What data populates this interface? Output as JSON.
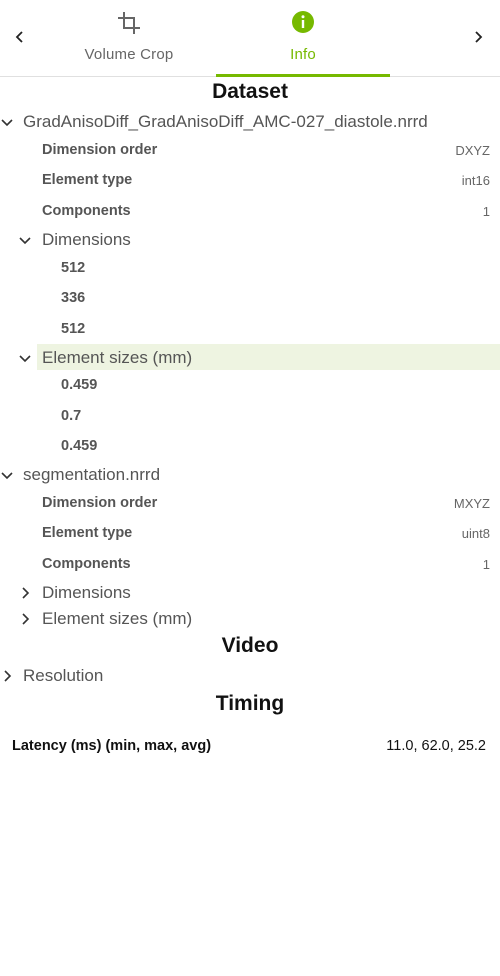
{
  "tabs": {
    "crop_label": "Volume Crop",
    "info_label": "Info"
  },
  "colors": {
    "accent": "#76b900",
    "highlight": "#eef4e1"
  },
  "dataset": {
    "title": "Dataset",
    "volumes": [
      {
        "name": "GradAnisoDiff_GradAnisoDiff_AMC-027_diastole.nrrd",
        "dimension_order_label": "Dimension order",
        "dimension_order": "DXYZ",
        "element_type_label": "Element type",
        "element_type": "int16",
        "components_label": "Components",
        "components": "1",
        "dimensions_label": "Dimensions",
        "dimensions": [
          "512",
          "336",
          "512"
        ],
        "element_sizes_label": "Element sizes (mm)",
        "element_sizes": [
          "0.459",
          "0.7",
          "0.459"
        ]
      },
      {
        "name": "segmentation.nrrd",
        "dimension_order_label": "Dimension order",
        "dimension_order": "MXYZ",
        "element_type_label": "Element type",
        "element_type": "uint8",
        "components_label": "Components",
        "components": "1",
        "dimensions_label": "Dimensions",
        "element_sizes_label": "Element sizes (mm)"
      }
    ]
  },
  "video": {
    "title": "Video",
    "resolution_label": "Resolution"
  },
  "timing": {
    "title": "Timing",
    "latency_label": "Latency (ms) (min, max, avg)",
    "latency_value": "11.0, 62.0, 25.2"
  }
}
